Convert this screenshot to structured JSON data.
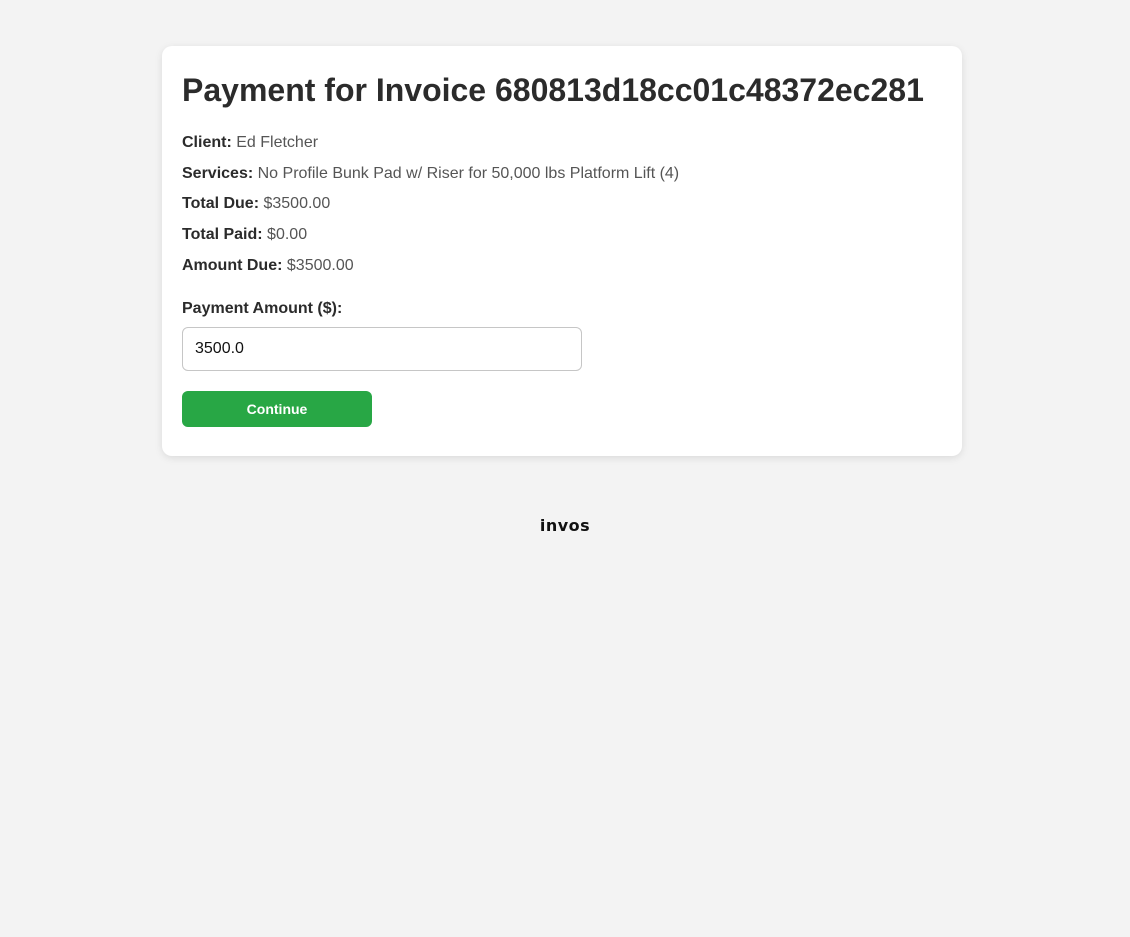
{
  "page": {
    "title_prefix": "Payment for Invoice ",
    "invoice_id": "680813d18cc01c48372ec281"
  },
  "details": {
    "client": {
      "label": "Client:",
      "value": "Ed Fletcher"
    },
    "services": {
      "label": "Services:",
      "value": "No Profile Bunk Pad w/ Riser for 50,000 lbs Platform Lift (4)"
    },
    "total_due": {
      "label": "Total Due:",
      "value": "$3500.00"
    },
    "total_paid": {
      "label": "Total Paid:",
      "value": "$0.00"
    },
    "amount_due": {
      "label": "Amount Due:",
      "value": "$3500.00"
    }
  },
  "payment": {
    "label": "Payment Amount ($):",
    "value": "3500.0"
  },
  "actions": {
    "continue_label": "Continue"
  },
  "footer": {
    "logo_text": "invos"
  },
  "colors": {
    "accent": "#28a745",
    "background": "#f3f3f3",
    "card": "#ffffff"
  }
}
